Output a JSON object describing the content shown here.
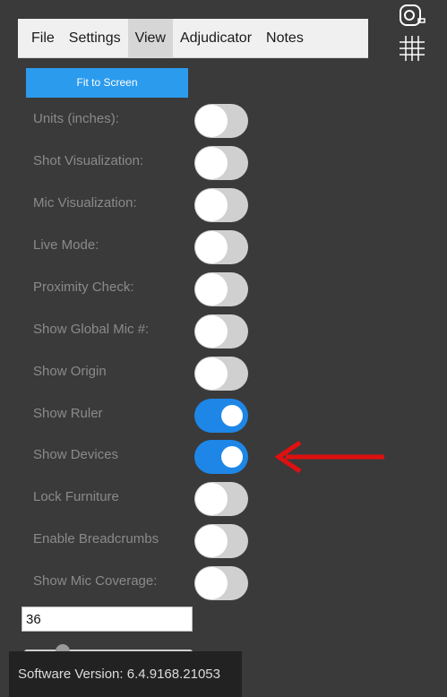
{
  "menu": {
    "items": [
      {
        "label": "File"
      },
      {
        "label": "Settings"
      },
      {
        "label": "View"
      },
      {
        "label": "Adjudicator"
      },
      {
        "label": "Notes"
      }
    ],
    "active": "View"
  },
  "toolbar": {
    "icons": [
      "tape-measure-icon",
      "grid-icon"
    ]
  },
  "fit_button": {
    "label": "Fit to Screen"
  },
  "settings": [
    {
      "label": "Units (inches):",
      "on": false
    },
    {
      "label": "Shot Visualization:",
      "on": false
    },
    {
      "label": "Mic Visualization:",
      "on": false
    },
    {
      "label": "Live Mode:",
      "on": false
    },
    {
      "label": "Proximity Check:",
      "on": false
    },
    {
      "label": "Show Global Mic #:",
      "on": false
    },
    {
      "label": "Show Origin",
      "on": false
    },
    {
      "label": "Show Ruler",
      "on": true
    },
    {
      "label": "Show Devices",
      "on": true
    },
    {
      "label": "Lock Furniture",
      "on": false
    },
    {
      "label": "Enable Breadcrumbs",
      "on": false
    },
    {
      "label": "Show Mic Coverage:",
      "on": false
    }
  ],
  "input": {
    "value": "36"
  },
  "footer": {
    "version_text": "Software Version: 6.4.9168.21053"
  },
  "colors": {
    "accent": "#2b9bed",
    "toggle_on": "#1e86e6",
    "toggle_off": "#d0d0d0",
    "background": "#3a3a3a",
    "arrow": "#e01010"
  }
}
